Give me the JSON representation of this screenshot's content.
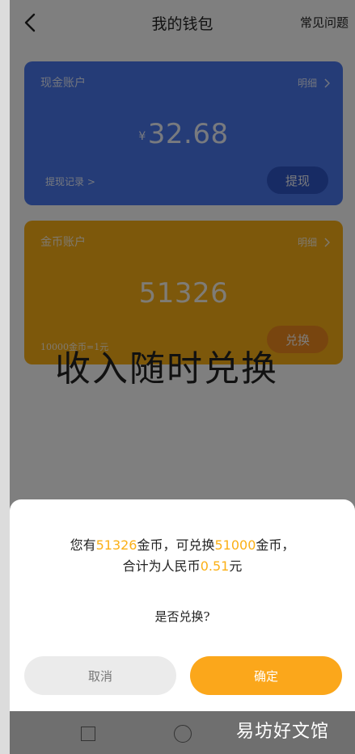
{
  "header": {
    "title": "我的钱包",
    "faq_label": "常见问题"
  },
  "cash_card": {
    "label": "现金账户",
    "detail_label": "明细",
    "currency": "¥",
    "amount": "32.68",
    "record_label": "提现记录 >",
    "action_label": "提现",
    "color": "#4a78ee"
  },
  "coin_card": {
    "label": "金币账户",
    "detail_label": "明细",
    "amount": "51326",
    "rate_note": "10000金币=1元",
    "action_label": "兑换",
    "color": "#fbb016"
  },
  "slogan": "收入随时兑换",
  "dialog": {
    "line1_prefix": "您有",
    "coins": "51326",
    "line1_mid": "金币，可兑换",
    "exchangeable": "51000",
    "line1_suffix": "金币，",
    "line2_prefix": "合计为人民币",
    "rmb": "0.51",
    "line2_suffix": "元",
    "question": "是否兑换?",
    "cancel_label": "取消",
    "confirm_label": "确定",
    "accent_color": "#fba71b"
  },
  "navbar": {
    "icons": [
      "square-recent-icon",
      "circle-home-icon"
    ]
  },
  "watermark": "易坊好文馆"
}
